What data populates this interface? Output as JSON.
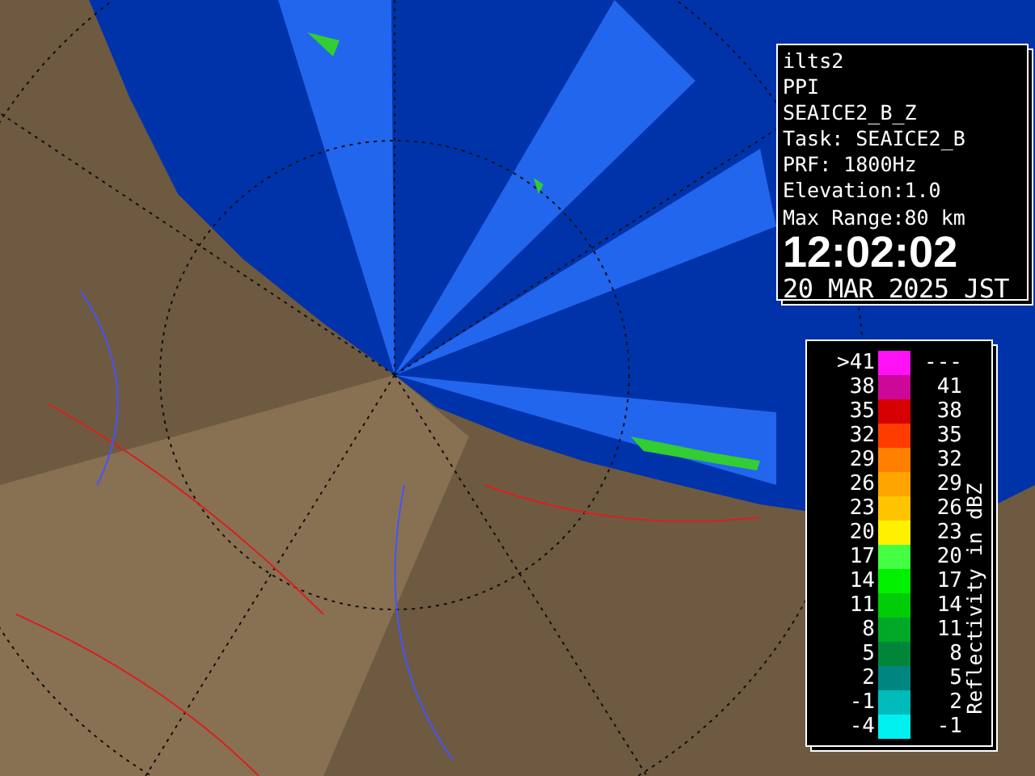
{
  "info_panel": {
    "lines": [
      "ilts2",
      "PPI",
      "SEAICE2_B_Z",
      "Task: SEAICE2_B",
      "PRF: 1800Hz",
      "Elevation:1.0",
      "Max Range:80 km"
    ],
    "time": "12:02:02",
    "date": "20 MAR 2025 JST"
  },
  "legend": {
    "title": "Reflectivity in dBZ",
    "rows": [
      {
        "low": ">41",
        "high": "---",
        "color": "#ff11f6"
      },
      {
        "low": "38",
        "high": "41",
        "color": "#cc0899"
      },
      {
        "low": "35",
        "high": "38",
        "color": "#d60000"
      },
      {
        "low": "32",
        "high": "35",
        "color": "#ff3c00"
      },
      {
        "low": "29",
        "high": "32",
        "color": "#ff8000"
      },
      {
        "low": "26",
        "high": "29",
        "color": "#ffa500"
      },
      {
        "low": "23",
        "high": "26",
        "color": "#ffc400"
      },
      {
        "low": "20",
        "high": "23",
        "color": "#fff000"
      },
      {
        "low": "17",
        "high": "20",
        "color": "#44ff44"
      },
      {
        "low": "14",
        "high": "17",
        "color": "#00f000"
      },
      {
        "low": "11",
        "high": "14",
        "color": "#00cc08"
      },
      {
        "low": "8",
        "high": "11",
        "color": "#00a828"
      },
      {
        "low": "5",
        "high": "8",
        "color": "#00853a"
      },
      {
        "low": "2",
        "high": "5",
        "color": "#008580"
      },
      {
        "low": "-1",
        "high": "2",
        "color": "#00bbbb"
      },
      {
        "low": "-4",
        "high": "-1",
        "color": "#00f0f0"
      }
    ]
  }
}
